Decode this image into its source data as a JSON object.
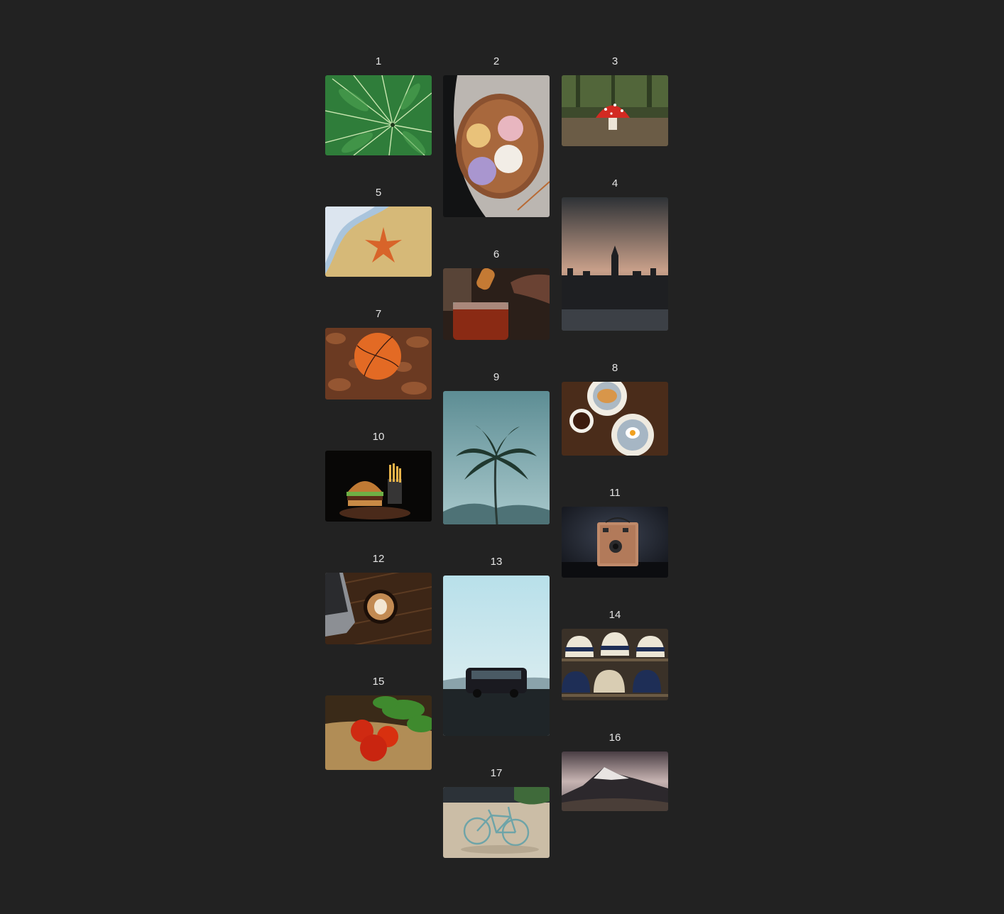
{
  "gallery": {
    "items": [
      {
        "number": "1",
        "subject": "fern-leaf"
      },
      {
        "number": "2",
        "subject": "wagashi-sweets"
      },
      {
        "number": "3",
        "subject": "red-mushroom"
      },
      {
        "number": "4",
        "subject": "big-ben-london"
      },
      {
        "number": "5",
        "subject": "starfish-beach"
      },
      {
        "number": "6",
        "subject": "honey-jar"
      },
      {
        "number": "7",
        "subject": "basketball-leaves"
      },
      {
        "number": "8",
        "subject": "breakfast-table"
      },
      {
        "number": "9",
        "subject": "palm-tree"
      },
      {
        "number": "10",
        "subject": "burger-fries"
      },
      {
        "number": "11",
        "subject": "vintage-camera"
      },
      {
        "number": "12",
        "subject": "latte-laptop"
      },
      {
        "number": "13",
        "subject": "van-sky"
      },
      {
        "number": "14",
        "subject": "hats-shelf"
      },
      {
        "number": "15",
        "subject": "tomatoes-basil"
      },
      {
        "number": "16",
        "subject": "snowy-mountain"
      },
      {
        "number": "17",
        "subject": "bicycle"
      }
    ]
  },
  "colors": {
    "background": "#222222",
    "label": "#e4e4e4"
  }
}
